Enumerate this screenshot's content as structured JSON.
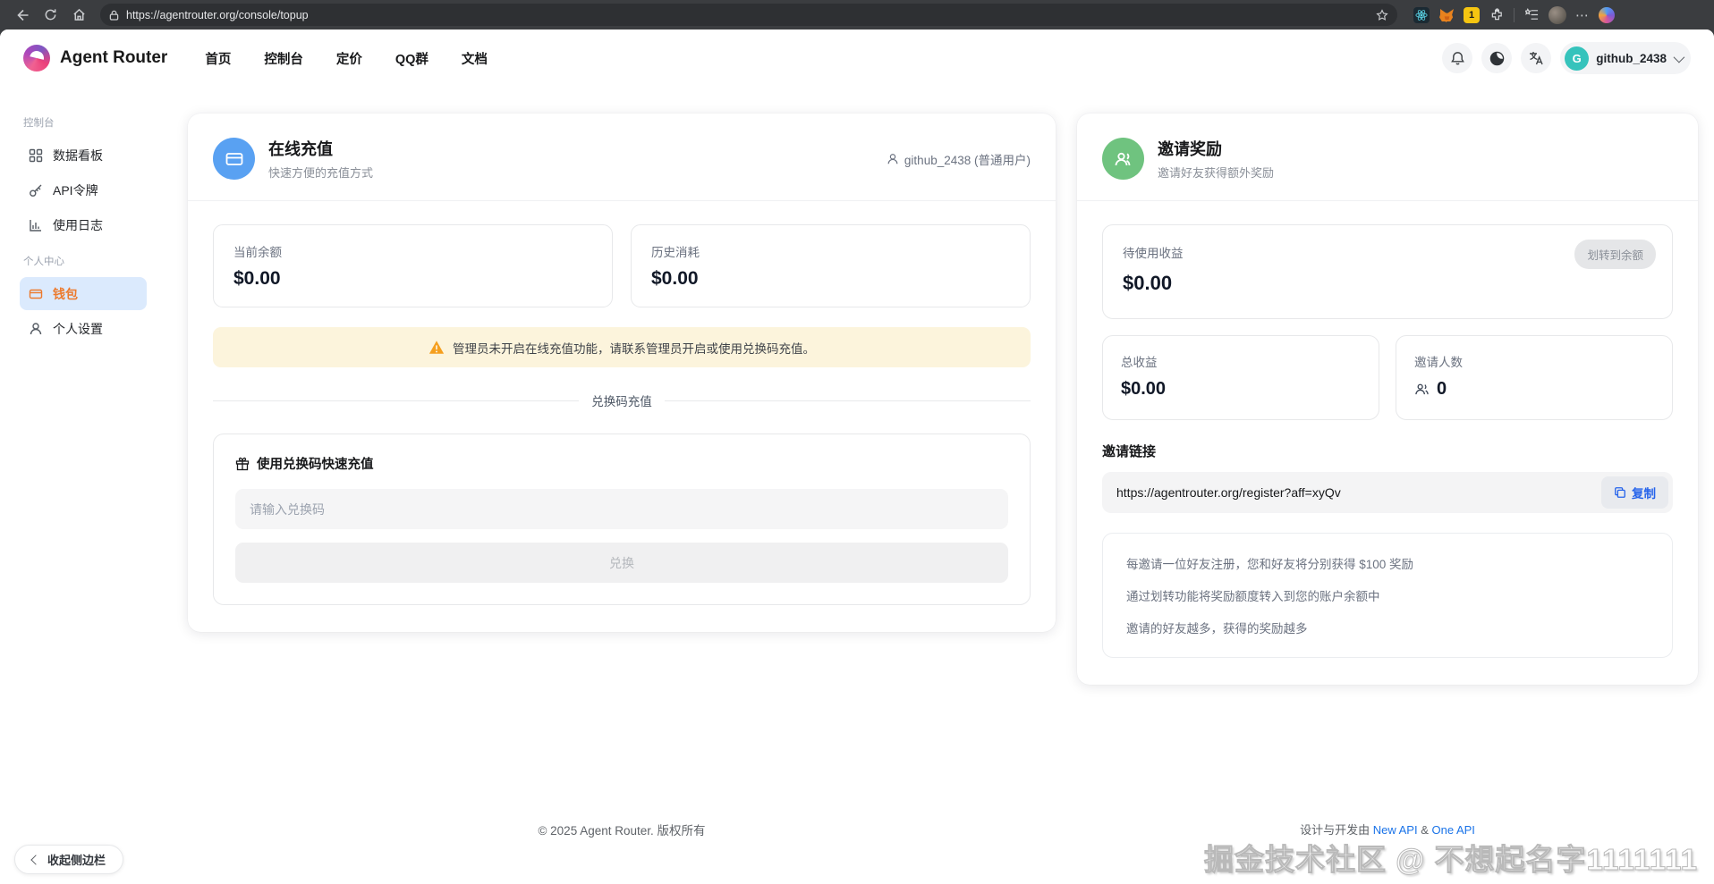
{
  "browser": {
    "url": "https://agentrouter.org/console/topup"
  },
  "header": {
    "brand": "Agent Router",
    "nav": [
      "首页",
      "控制台",
      "定价",
      "QQ群",
      "文档"
    ],
    "user_name": "github_2438",
    "avatar_initial": "G"
  },
  "sidebar": {
    "section_console": "控制台",
    "item_dashboard": "数据看板",
    "item_tokens": "API令牌",
    "item_logs": "使用日志",
    "section_personal": "个人中心",
    "item_wallet": "钱包",
    "item_settings": "个人设置",
    "collapse_label": "收起侧边栏"
  },
  "topup": {
    "title": "在线充值",
    "subtitle": "快速方便的充值方式",
    "user_badge": "github_2438 (普通用户)",
    "balance_label": "当前余额",
    "balance_value": "$0.00",
    "history_label": "历史消耗",
    "history_value": "$0.00",
    "warning": "管理员未开启在线充值功能，请联系管理员开启或使用兑换码充值。",
    "divider_label": "兑换码充值",
    "redeem_title": "使用兑换码快速充值",
    "redeem_placeholder": "请输入兑换码",
    "redeem_button": "兑换"
  },
  "invite": {
    "title": "邀请奖励",
    "subtitle": "邀请好友获得额外奖励",
    "pending_label": "待使用收益",
    "pending_value": "$0.00",
    "transfer_button": "划转到余额",
    "total_label": "总收益",
    "total_value": "$0.00",
    "count_label": "邀请人数",
    "count_value": "0",
    "link_heading": "邀请链接",
    "link_url": "https://agentrouter.org/register?aff=xyQv",
    "copy_button": "复制",
    "tip1": "每邀请一位好友注册，您和好友将分别获得 $100 奖励",
    "tip2": "通过划转功能将奖励额度转入到您的账户余额中",
    "tip3": "邀请的好友越多，获得的奖励越多"
  },
  "footer": {
    "copyright": "© 2025 Agent Router. 版权所有",
    "credits_prefix": "设计与开发由",
    "link_new_api": "New API",
    "separator": "&",
    "link_one_api": "One API"
  },
  "watermark": "掘金技术社区 @ 不想起名字1111111",
  "colors": {
    "topup_icon_bg": "#59a1f2",
    "invite_icon_bg": "#6fc37f",
    "active_item_text": "#ec7a2d",
    "active_item_bg": "#dbeafd",
    "warning_bg": "#fcf4dc",
    "link_blue": "#1a73e8",
    "copy_blue": "#2563eb",
    "avatar_teal": "#36c3bc"
  }
}
